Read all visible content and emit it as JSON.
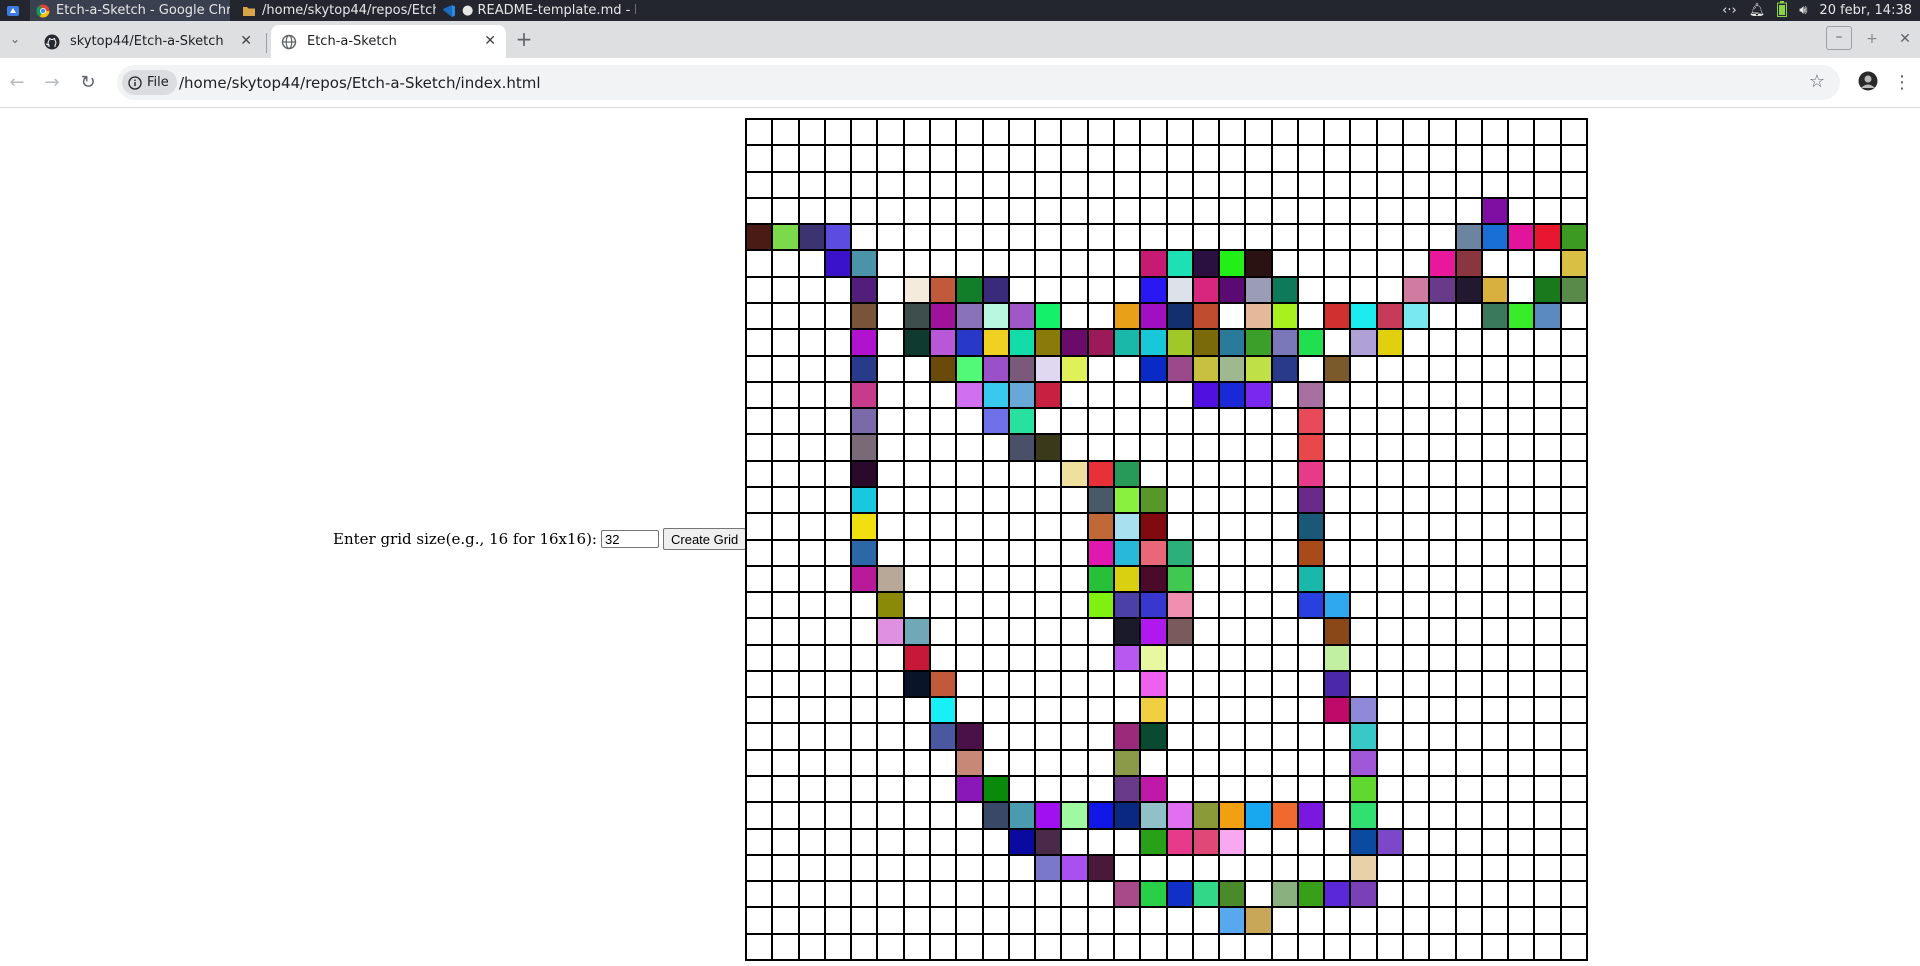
{
  "taskbar": {
    "apps": [
      {
        "label": "Etch-a-Sketch - Google Chro...",
        "icon": "chrome-icon",
        "active": true
      },
      {
        "label": "/home/skytop44/repos/Etch-...",
        "icon": "folder-icon",
        "active": false
      },
      {
        "label": "● README-template.md - Et...",
        "icon": "vscode-icon",
        "active": false
      }
    ],
    "clock": "20 febr, 14:38"
  },
  "tabs": [
    {
      "title": "skytop44/Etch-a-Sketch",
      "icon": "github-icon"
    },
    {
      "title": "Etch-a-Sketch",
      "icon": "globe-icon"
    }
  ],
  "address_bar": {
    "chip": "File",
    "url": "/home/skytop44/repos/Etch-a-Sketch/index.html"
  },
  "controls": {
    "label": "Enter grid size(e.g., 16 for 16x16):",
    "input_value": "32",
    "button_label": "Create Grid"
  },
  "grid": {
    "size": 32,
    "colored_cells": [
      [
        3,
        28,
        "#7f0fa2"
      ],
      [
        4,
        0,
        "#4a1a14"
      ],
      [
        4,
        1,
        "#7bd94a"
      ],
      [
        4,
        2,
        "#3b3470"
      ],
      [
        4,
        3,
        "#5c4de0"
      ],
      [
        4,
        27,
        "#6b84a0"
      ],
      [
        4,
        28,
        "#1a6fd6"
      ],
      [
        4,
        29,
        "#e2149c"
      ],
      [
        4,
        30,
        "#e8162e"
      ],
      [
        4,
        31,
        "#3c9a22"
      ],
      [
        5,
        3,
        "#3a12c9"
      ],
      [
        5,
        4,
        "#4a93a8"
      ],
      [
        5,
        15,
        "#c71a72"
      ],
      [
        5,
        16,
        "#1de0b4"
      ],
      [
        5,
        17,
        "#2a1040"
      ],
      [
        5,
        18,
        "#22ee18"
      ],
      [
        5,
        19,
        "#2a1212"
      ],
      [
        5,
        26,
        "#e8179c"
      ],
      [
        5,
        27,
        "#8a3640"
      ],
      [
        5,
        31,
        "#d8c044"
      ],
      [
        6,
        4,
        "#531d7a"
      ],
      [
        6,
        6,
        "#f5ebdc"
      ],
      [
        6,
        7,
        "#c05a3a"
      ],
      [
        6,
        8,
        "#127e2a"
      ],
      [
        6,
        9,
        "#3a2a7a"
      ],
      [
        6,
        15,
        "#2a18f4"
      ],
      [
        6,
        16,
        "#dde2ea"
      ],
      [
        6,
        17,
        "#d8267e"
      ],
      [
        6,
        18,
        "#5a0a72"
      ],
      [
        6,
        19,
        "#9a9cb8"
      ],
      [
        6,
        20,
        "#0e7a5a"
      ],
      [
        6,
        25,
        "#d07ca0"
      ],
      [
        6,
        26,
        "#6a3a8a"
      ],
      [
        6,
        27,
        "#221830"
      ],
      [
        6,
        28,
        "#d8b040"
      ],
      [
        6,
        30,
        "#187a1a"
      ],
      [
        6,
        31,
        "#5a8a4a"
      ],
      [
        7,
        4,
        "#7a5438"
      ],
      [
        7,
        6,
        "#3e4e4c"
      ],
      [
        7,
        7,
        "#a0129a"
      ],
      [
        7,
        8,
        "#8a72b8"
      ],
      [
        7,
        9,
        "#b8f8e0"
      ],
      [
        7,
        10,
        "#a058c8"
      ],
      [
        7,
        11,
        "#14f06a"
      ],
      [
        7,
        14,
        "#e8a018"
      ],
      [
        7,
        15,
        "#a010c0"
      ],
      [
        7,
        16,
        "#12306e"
      ],
      [
        7,
        17,
        "#c04c30"
      ],
      [
        7,
        19,
        "#e4b898"
      ],
      [
        7,
        20,
        "#a8f01e"
      ],
      [
        7,
        22,
        "#d03030"
      ],
      [
        7,
        23,
        "#1cecf0"
      ],
      [
        7,
        24,
        "#c83a5a"
      ],
      [
        7,
        25,
        "#7ae8f0"
      ],
      [
        7,
        28,
        "#3a7a5a"
      ],
      [
        7,
        29,
        "#38ec2a"
      ],
      [
        7,
        30,
        "#5a8ac0"
      ],
      [
        8,
        4,
        "#b012d0"
      ],
      [
        8,
        6,
        "#0e3a30"
      ],
      [
        8,
        7,
        "#b858d8"
      ],
      [
        8,
        8,
        "#2838c8"
      ],
      [
        8,
        9,
        "#f0d020"
      ],
      [
        8,
        10,
        "#12dca8"
      ],
      [
        8,
        11,
        "#8a7a0a"
      ],
      [
        8,
        12,
        "#6a0a6a"
      ],
      [
        8,
        13,
        "#9a1a5a"
      ],
      [
        8,
        14,
        "#1ab8a8"
      ],
      [
        8,
        15,
        "#18c8d8"
      ],
      [
        8,
        16,
        "#a0c828"
      ],
      [
        8,
        17,
        "#7a6a0a"
      ],
      [
        8,
        18,
        "#2a7a9a"
      ],
      [
        8,
        19,
        "#3aa02a"
      ],
      [
        8,
        20,
        "#7a78b8"
      ],
      [
        8,
        21,
        "#20e050"
      ],
      [
        8,
        23,
        "#b0a0d8"
      ],
      [
        8,
        24,
        "#e0d010"
      ],
      [
        9,
        4,
        "#2a3a8a"
      ],
      [
        9,
        7,
        "#6a4a08"
      ],
      [
        9,
        8,
        "#52f878"
      ],
      [
        9,
        9,
        "#9a50c8"
      ],
      [
        9,
        10,
        "#7a5a7a"
      ],
      [
        9,
        11,
        "#e0d8f0"
      ],
      [
        9,
        12,
        "#e0f058"
      ],
      [
        9,
        15,
        "#0a2ac8"
      ],
      [
        9,
        16,
        "#9a4a8a"
      ],
      [
        9,
        17,
        "#c8c040"
      ],
      [
        9,
        18,
        "#a0b890"
      ],
      [
        9,
        19,
        "#c0e048"
      ],
      [
        9,
        20,
        "#2a3a8a"
      ],
      [
        9,
        22,
        "#7a5a2a"
      ],
      [
        10,
        4,
        "#c83a8a"
      ],
      [
        10,
        8,
        "#d070f0"
      ],
      [
        10,
        9,
        "#38c8f0"
      ],
      [
        10,
        10,
        "#68a8d8"
      ],
      [
        10,
        11,
        "#c82040"
      ],
      [
        10,
        17,
        "#5010e0"
      ],
      [
        10,
        18,
        "#1a28d8"
      ],
      [
        10,
        19,
        "#7a28f0"
      ],
      [
        10,
        21,
        "#a870a0"
      ],
      [
        11,
        4,
        "#7a6aa8"
      ],
      [
        11,
        9,
        "#7070e8"
      ],
      [
        11,
        10,
        "#28e0a0"
      ],
      [
        11,
        21,
        "#e84a5a"
      ],
      [
        12,
        4,
        "#7a6a78"
      ],
      [
        12,
        10,
        "#4a5068"
      ],
      [
        12,
        11,
        "#3a3a1a"
      ],
      [
        12,
        21,
        "#e8484a"
      ],
      [
        13,
        4,
        "#2a0a2a"
      ],
      [
        13,
        12,
        "#f0e0a0"
      ],
      [
        13,
        13,
        "#e83038"
      ],
      [
        13,
        14,
        "#289a58"
      ],
      [
        13,
        21,
        "#e83a8a"
      ],
      [
        14,
        4,
        "#18c8e0"
      ],
      [
        14,
        13,
        "#485a68"
      ],
      [
        14,
        14,
        "#8af040"
      ],
      [
        14,
        15,
        "#58982a"
      ],
      [
        14,
        21,
        "#6a2a8a"
      ],
      [
        15,
        4,
        "#f0e010"
      ],
      [
        15,
        13,
        "#c06838"
      ],
      [
        15,
        14,
        "#a8e0f0"
      ],
      [
        15,
        15,
        "#800a10"
      ],
      [
        15,
        21,
        "#1a5878"
      ],
      [
        16,
        4,
        "#2a68a8"
      ],
      [
        16,
        13,
        "#e018b0"
      ],
      [
        16,
        14,
        "#28b8d8"
      ],
      [
        16,
        15,
        "#e86878"
      ],
      [
        16,
        16,
        "#2ab078"
      ],
      [
        16,
        21,
        "#a84a1a"
      ],
      [
        17,
        4,
        "#b81a9a"
      ],
      [
        17,
        5,
        "#b8a898"
      ],
      [
        17,
        13,
        "#28c038"
      ],
      [
        17,
        14,
        "#d8d010"
      ],
      [
        17,
        15,
        "#4a0a2a"
      ],
      [
        17,
        16,
        "#40c850"
      ],
      [
        17,
        21,
        "#1ab8a8"
      ],
      [
        18,
        5,
        "#8a8a08"
      ],
      [
        18,
        13,
        "#80f010"
      ],
      [
        18,
        14,
        "#4a40a8"
      ],
      [
        18,
        15,
        "#3838d0"
      ],
      [
        18,
        16,
        "#f090b0"
      ],
      [
        18,
        21,
        "#2840e0"
      ],
      [
        18,
        22,
        "#30a8f0"
      ],
      [
        19,
        5,
        "#e090e0"
      ],
      [
        19,
        6,
        "#70a8b8"
      ],
      [
        19,
        14,
        "#1a1a2a"
      ],
      [
        19,
        15,
        "#b018f0"
      ],
      [
        19,
        16,
        "#7a5a5a"
      ],
      [
        19,
        22,
        "#8a4818"
      ],
      [
        20,
        6,
        "#c81838"
      ],
      [
        20,
        14,
        "#b858f0"
      ],
      [
        20,
        15,
        "#e8f8a0"
      ],
      [
        20,
        22,
        "#c0f0a0"
      ],
      [
        21,
        6,
        "#0a1428"
      ],
      [
        21,
        7,
        "#c05a3a"
      ],
      [
        21,
        15,
        "#f060f0"
      ],
      [
        21,
        22,
        "#4a28a8"
      ],
      [
        22,
        7,
        "#18f0f8"
      ],
      [
        22,
        15,
        "#f0d040"
      ],
      [
        22,
        22,
        "#c00a6a"
      ],
      [
        22,
        23,
        "#9088d8"
      ],
      [
        23,
        7,
        "#4a58a0"
      ],
      [
        23,
        8,
        "#4a1048"
      ],
      [
        23,
        14,
        "#9a2a7a"
      ],
      [
        23,
        15,
        "#0a4a30"
      ],
      [
        23,
        23,
        "#38c8c8"
      ],
      [
        24,
        8,
        "#c88878"
      ],
      [
        24,
        14,
        "#8a9a48"
      ],
      [
        24,
        23,
        "#a058d8"
      ],
      [
        25,
        8,
        "#8a18b8"
      ],
      [
        25,
        9,
        "#0a8a0a"
      ],
      [
        25,
        14,
        "#6a3a8a"
      ],
      [
        25,
        15,
        "#c018a8"
      ],
      [
        25,
        23,
        "#60d830"
      ],
      [
        26,
        9,
        "#3a4868"
      ],
      [
        26,
        10,
        "#4a9ab0"
      ],
      [
        26,
        11,
        "#a010f0"
      ],
      [
        26,
        12,
        "#a0f8a0"
      ],
      [
        26,
        13,
        "#1018e8"
      ],
      [
        26,
        14,
        "#0a2880"
      ],
      [
        26,
        15,
        "#90c0c8"
      ],
      [
        26,
        16,
        "#e070f0"
      ],
      [
        26,
        17,
        "#8a9a38"
      ],
      [
        26,
        18,
        "#f0a010"
      ],
      [
        26,
        19,
        "#18a8f0"
      ],
      [
        26,
        20,
        "#f06a30"
      ],
      [
        26,
        21,
        "#7a18e0"
      ],
      [
        26,
        23,
        "#30e070"
      ],
      [
        27,
        10,
        "#0a0aa0"
      ],
      [
        27,
        11,
        "#4a2a4a"
      ],
      [
        27,
        15,
        "#28a018"
      ],
      [
        27,
        16,
        "#e83a8a"
      ],
      [
        27,
        17,
        "#e04878"
      ],
      [
        27,
        18,
        "#f8a8f0"
      ],
      [
        27,
        23,
        "#0a4aa0"
      ],
      [
        27,
        24,
        "#7a48c8"
      ],
      [
        28,
        11,
        "#7a78c8"
      ],
      [
        28,
        12,
        "#a850f0"
      ],
      [
        28,
        13,
        "#4a1838"
      ],
      [
        28,
        23,
        "#e8d0a8"
      ],
      [
        29,
        14,
        "#a84a8a"
      ],
      [
        29,
        15,
        "#28d048"
      ],
      [
        29,
        16,
        "#1030c8"
      ],
      [
        29,
        17,
        "#30d888"
      ],
      [
        29,
        18,
        "#4a8a2a"
      ],
      [
        29,
        20,
        "#8ab080"
      ],
      [
        29,
        21,
        "#38a018"
      ],
      [
        29,
        22,
        "#5a28d8"
      ],
      [
        29,
        23,
        "#7a40b8"
      ],
      [
        30,
        18,
        "#58a8f0"
      ],
      [
        30,
        19,
        "#c8a858"
      ]
    ]
  }
}
